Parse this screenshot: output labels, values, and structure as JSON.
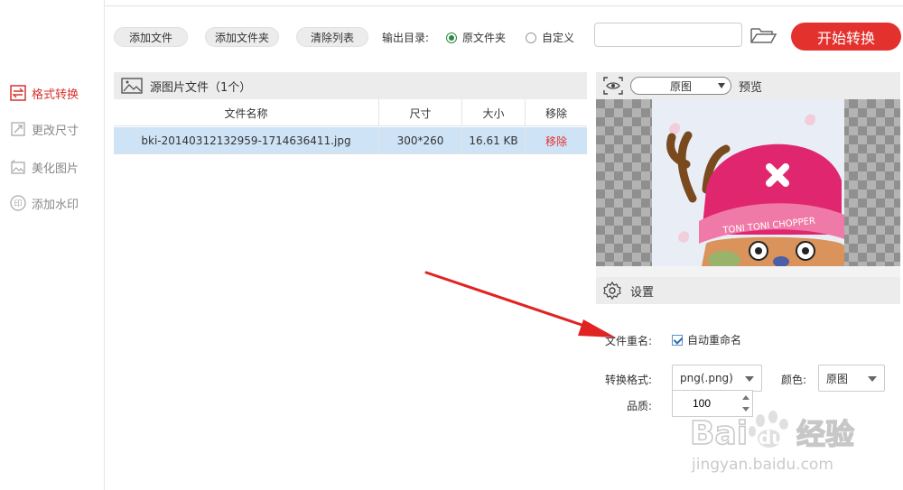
{
  "sidebar": {
    "items": [
      {
        "label": "格式转换",
        "icon": "swap-icon",
        "active": true
      },
      {
        "label": "更改尺寸",
        "icon": "resize-icon",
        "active": false
      },
      {
        "label": "美化图片",
        "icon": "beautify-icon",
        "active": false
      },
      {
        "label": "添加水印",
        "icon": "watermark-seal-icon",
        "active": false
      }
    ]
  },
  "toolbar": {
    "add_file": "添加文件",
    "add_folder": "添加文件夹",
    "clear_list": "清除列表",
    "output_label": "输出目录:",
    "radio_original": "原文件夹",
    "radio_custom": "自定义",
    "selected_radio": "原文件夹",
    "output_path": "",
    "folder_icon": "folder-open-icon",
    "start_button": "开始转换"
  },
  "file_panel": {
    "title": "源图片文件（1个）",
    "columns": [
      "文件名称",
      "尺寸",
      "大小",
      "移除"
    ],
    "rows": [
      {
        "name": "bki-20140312132959-1714636411.jpg",
        "dimensions": "300*260",
        "size": "16.61 KB",
        "remove": "移除"
      }
    ]
  },
  "preview": {
    "mode": "原图",
    "label": "预览",
    "image_caption": "TONI TONI CHOPPER"
  },
  "settings": {
    "title": "设置",
    "rename_label": "文件重名:",
    "auto_rename": "自动重命名",
    "auto_rename_checked": true,
    "format_label": "转换格式:",
    "format_value": "png(.png)",
    "color_label": "颜色:",
    "color_value": "原图",
    "quality_label": "品质:",
    "quality_value": "100"
  },
  "watermark": {
    "brand": "Baidu经验",
    "url": "jingyan.baidu.com"
  },
  "colors": {
    "accent": "#e3312d",
    "selected_row": "#cfe3f6",
    "radio_on": "#2b8a3e"
  }
}
